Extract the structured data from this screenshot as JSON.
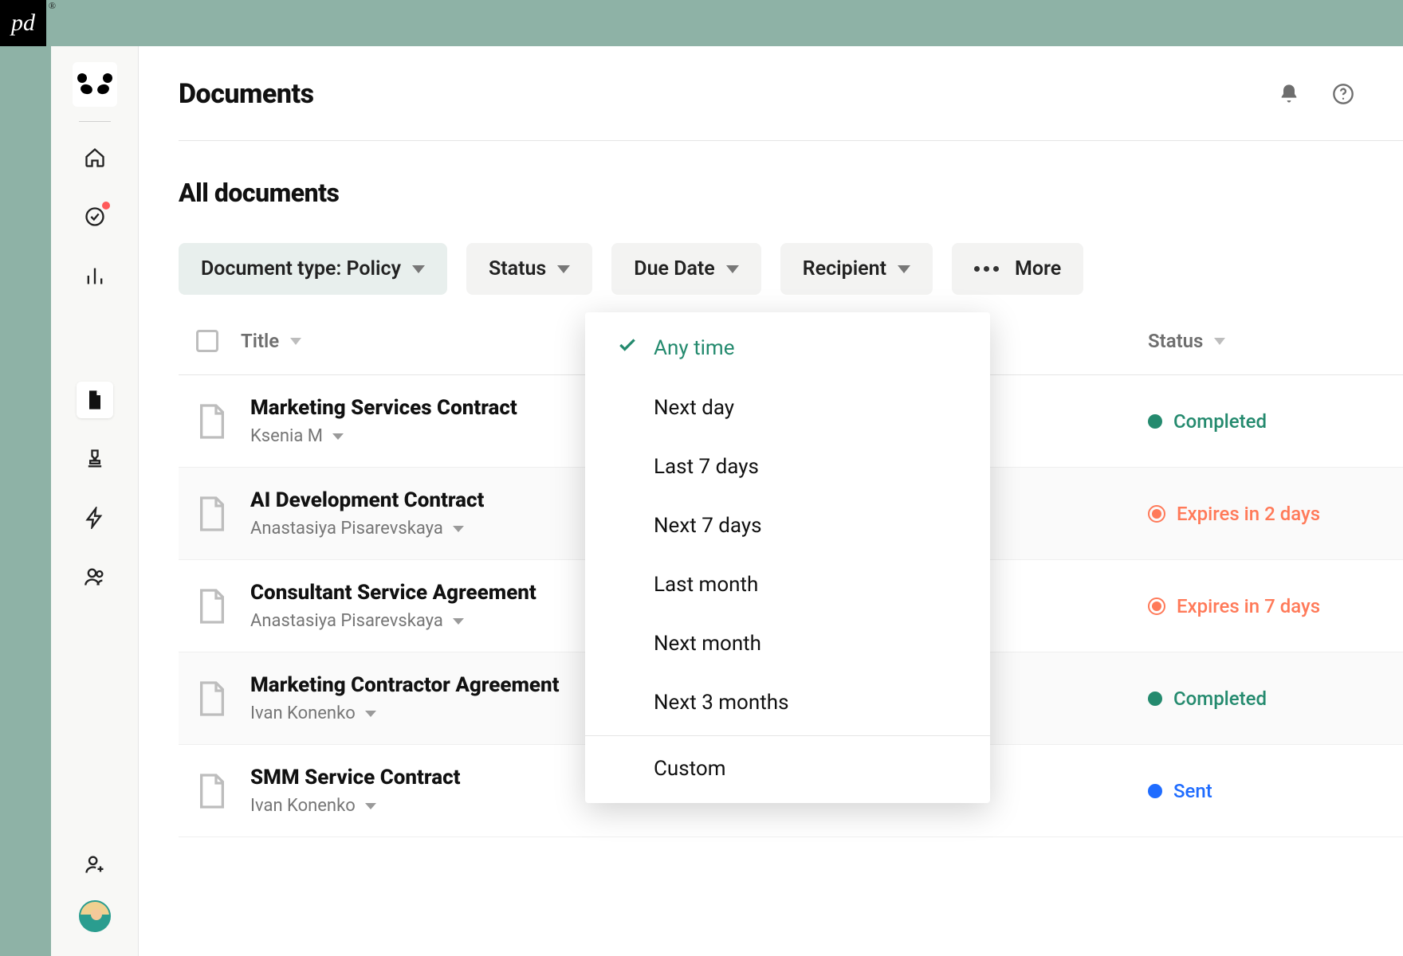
{
  "brand": "pd",
  "header": {
    "title": "Documents"
  },
  "section": {
    "title": "All documents"
  },
  "filters": {
    "doc_type": "Document type: Policy",
    "status": "Status",
    "due_date": "Due Date",
    "recipient": "Recipient",
    "more": "More"
  },
  "columns": {
    "title": "Title",
    "status": "Status"
  },
  "due_date_options": [
    {
      "label": "Any time",
      "selected": true
    },
    {
      "label": "Next day",
      "selected": false
    },
    {
      "label": "Last 7 days",
      "selected": false
    },
    {
      "label": "Next 7 days",
      "selected": false
    },
    {
      "label": "Last month",
      "selected": false
    },
    {
      "label": "Next month",
      "selected": false
    },
    {
      "label": "Next 3 months",
      "selected": false
    }
  ],
  "due_date_custom": "Custom",
  "documents": [
    {
      "title": "Marketing Services Contract",
      "author": "Ksenia M",
      "status_text": "Completed",
      "status_kind": "completed"
    },
    {
      "title": "AI Development Contract",
      "author": "Anastasiya Pisarevskaya",
      "status_text": "Expires in 2 days",
      "status_kind": "expires"
    },
    {
      "title": "Consultant Service Agreement",
      "author": "Anastasiya Pisarevskaya",
      "status_text": "Expires in 7 days",
      "status_kind": "expires"
    },
    {
      "title": "Marketing Contractor Agreement",
      "author": "Ivan Konenko",
      "status_text": "Completed",
      "status_kind": "completed"
    },
    {
      "title": "SMM Service Contract",
      "author": "Ivan Konenko",
      "status_text": "Sent",
      "status_kind": "sent"
    }
  ],
  "sidebar_icons": [
    "home",
    "target",
    "chart",
    "document",
    "stamp",
    "bolt",
    "people"
  ],
  "colors": {
    "green": "#248a6e",
    "orange": "#ff7a59",
    "blue": "#1f6cff"
  }
}
